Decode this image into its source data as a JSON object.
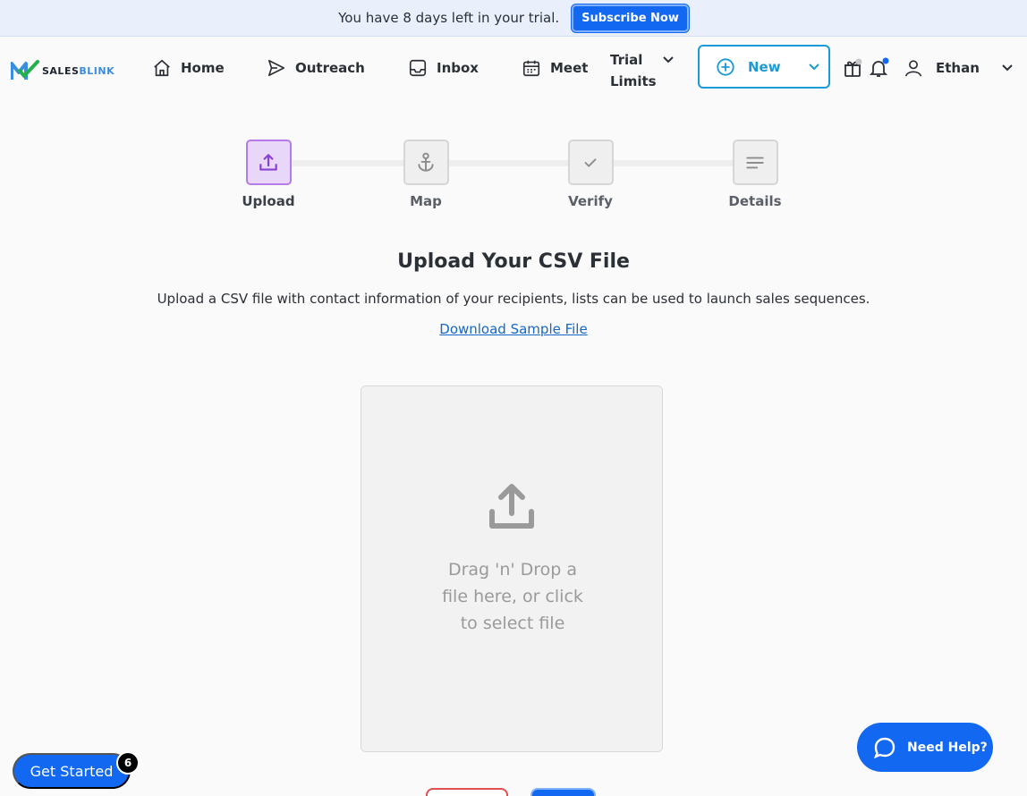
{
  "trial_banner": {
    "text": "You have 8 days left in your trial.",
    "subscribe_label": "Subscribe Now"
  },
  "nav": {
    "logo": {
      "part1": "SALES",
      "part2": "BLINK"
    },
    "home": "Home",
    "outreach": "Outreach",
    "inbox": "Inbox",
    "meet": "Meet",
    "trial_limits_line1": "Trial",
    "trial_limits_line2": "Limits",
    "new_label": "New",
    "user_name": "Ethan"
  },
  "stepper": {
    "steps": [
      {
        "label": "Upload",
        "icon": "upload-icon",
        "active": true
      },
      {
        "label": "Map",
        "icon": "anchor-icon",
        "active": false
      },
      {
        "label": "Verify",
        "icon": "check-icon",
        "active": false
      },
      {
        "label": "Details",
        "icon": "lines-icon",
        "active": false
      }
    ]
  },
  "content": {
    "title": "Upload Your CSV File",
    "description": "Upload a CSV file with contact information of your recipients, lists can be used to launch sales sequences.",
    "sample_link": "Download Sample File",
    "dropzone_text": "Drag 'n' Drop a file here, or click to select file"
  },
  "floating": {
    "get_started": "Get Started",
    "get_started_badge": "6",
    "need_help": "Need Help?"
  },
  "colors": {
    "primary": "#1268f0",
    "accent_cyan": "#1a9ad6",
    "step_active_bg": "#e8d7f8",
    "step_active_border": "#b57ce8"
  }
}
